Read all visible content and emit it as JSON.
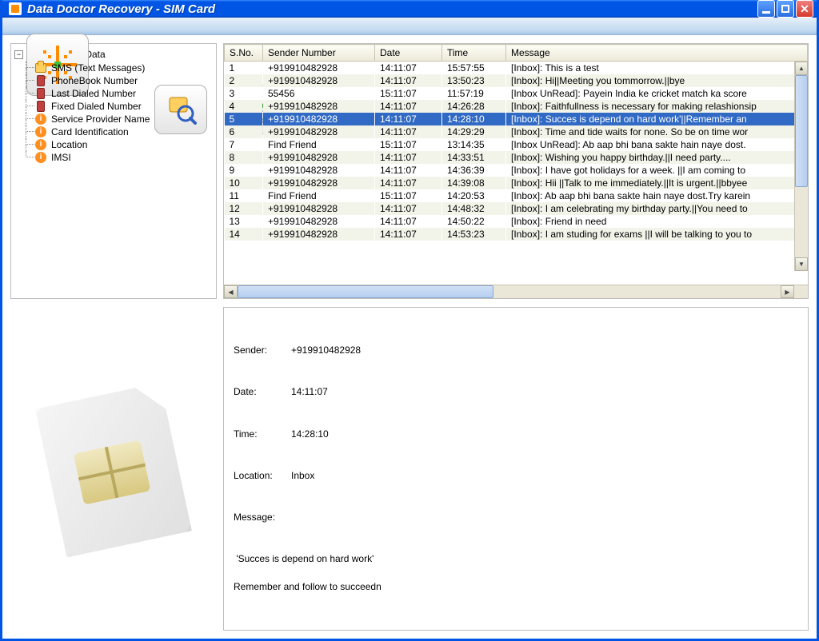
{
  "window": {
    "title": "Data Doctor Recovery - SIM Card"
  },
  "brand": {
    "line1": "Data Doctor Recovery",
    "line2": "SIM Card"
  },
  "toolbar": {
    "scan": "scan-icon",
    "save": "save-icon",
    "help": "help-icon",
    "close": "close-icon"
  },
  "tree": {
    "root": "Sim Card Data",
    "items": [
      {
        "label": "SMS (Text Messages)",
        "iconType": "sms"
      },
      {
        "label": "PhoneBook Number",
        "iconType": "phone"
      },
      {
        "label": "Last Dialed Number",
        "iconType": "phone"
      },
      {
        "label": "Fixed Dialed Number",
        "iconType": "phone"
      },
      {
        "label": "Service Provider Name",
        "iconType": "info"
      },
      {
        "label": "Card Identification",
        "iconType": "info"
      },
      {
        "label": "Location",
        "iconType": "info"
      },
      {
        "label": "IMSI",
        "iconType": "info"
      }
    ]
  },
  "table": {
    "headers": {
      "sno": "S.No.",
      "sender": "Sender Number",
      "date": "Date",
      "time": "Time",
      "message": "Message"
    },
    "rows": [
      {
        "sno": "1",
        "sender": "+919910482928",
        "date": "14:11:07",
        "time": "15:57:55",
        "message": "[Inbox]: This is a test"
      },
      {
        "sno": "2",
        "sender": "+919910482928",
        "date": "14:11:07",
        "time": "13:50:23",
        "message": "[Inbox]: Hi||Meeting you tommorrow.||bye"
      },
      {
        "sno": "3",
        "sender": "55456",
        "date": "15:11:07",
        "time": "11:57:19",
        "message": "[Inbox UnRead]: Payein India ke cricket match ka score"
      },
      {
        "sno": "4",
        "sender": "+919910482928",
        "date": "14:11:07",
        "time": "14:26:28",
        "message": "[Inbox]: Faithfullness is necessary for making relashionsip"
      },
      {
        "sno": "5",
        "sender": "+919910482928",
        "date": "14:11:07",
        "time": "14:28:10",
        "message": "[Inbox]: Succes is depend on hard work'||Remember an",
        "selected": true
      },
      {
        "sno": "6",
        "sender": "+919910482928",
        "date": "14:11:07",
        "time": "14:29:29",
        "message": "[Inbox]: Time and tide waits for none. So be on time wor"
      },
      {
        "sno": "7",
        "sender": "Find Friend",
        "date": "15:11:07",
        "time": "13:14:35",
        "message": "[Inbox UnRead]: Ab aap bhi bana sakte hain naye dost."
      },
      {
        "sno": "8",
        "sender": "+919910482928",
        "date": "14:11:07",
        "time": "14:33:51",
        "message": "[Inbox]: Wishing you happy birthday.||I need party...."
      },
      {
        "sno": "9",
        "sender": "+919910482928",
        "date": "14:11:07",
        "time": "14:36:39",
        "message": "[Inbox]: I have got holidays for a week. ||I am coming to"
      },
      {
        "sno": "10",
        "sender": "+919910482928",
        "date": "14:11:07",
        "time": "14:39:08",
        "message": "[Inbox]: Hii ||Talk to me immediately.||It is urgent.||bbyee"
      },
      {
        "sno": "11",
        "sender": "Find Friend",
        "date": "15:11:07",
        "time": "14:20:53",
        "message": "[Inbox]: Ab aap bhi bana sakte hain naye dost.Try karein"
      },
      {
        "sno": "12",
        "sender": "+919910482928",
        "date": "14:11:07",
        "time": "14:48:32",
        "message": "[Inbox]: I am celebrating my birthday party.||You need to"
      },
      {
        "sno": "13",
        "sender": "+919910482928",
        "date": "14:11:07",
        "time": "14:50:22",
        "message": "[Inbox]: Friend in need"
      },
      {
        "sno": "14",
        "sender": "+919910482928",
        "date": "14:11:07",
        "time": "14:53:23",
        "message": "[Inbox]: I am studing for exams ||I will be talking to you to"
      }
    ]
  },
  "detail": {
    "labels": {
      "sender": "Sender:",
      "date": "Date:",
      "time": "Time:",
      "location": "Location:",
      "message": "Message:"
    },
    "sender": "+919910482928",
    "date": "14:11:07",
    "time": "14:28:10",
    "location": "Inbox",
    "messageBody": " 'Succes is depend on hard work'\n\nRemember and follow to succeedn"
  }
}
